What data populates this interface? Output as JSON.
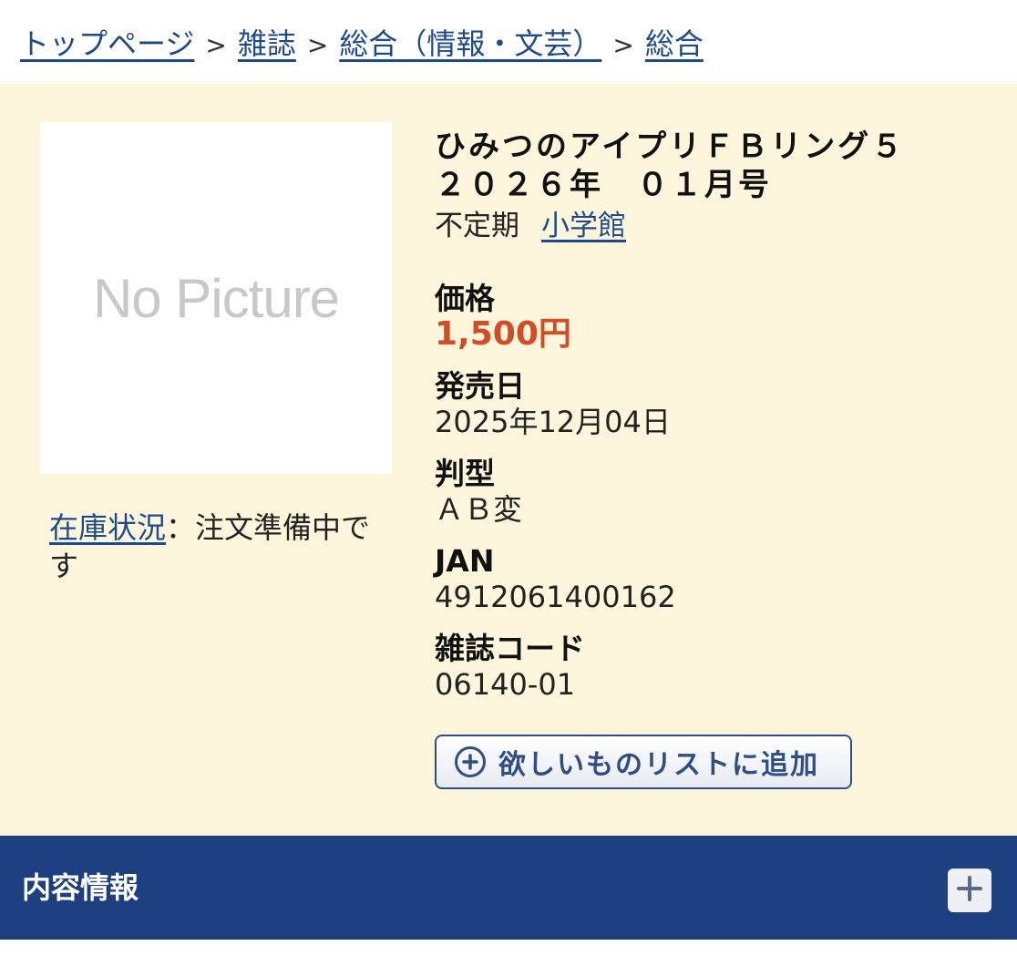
{
  "breadcrumb": {
    "items": [
      "トップページ",
      "雑誌",
      "総合（情報・文芸）",
      "総合"
    ],
    "separator": ">"
  },
  "image_placeholder": "No Picture",
  "stock": {
    "link_label": "在庫状況",
    "status": "：注文準備中です"
  },
  "product": {
    "title_line1": "ひみつのアイプリＦＢリング５",
    "title_line2": "２０２６年　０１月号",
    "frequency": "不定期",
    "publisher": "小学館"
  },
  "fields": {
    "price_label": "価格",
    "price_value": "1,500円",
    "release_label": "発売日",
    "release_value": "2025年12月04日",
    "size_label": "判型",
    "size_value": "ＡＢ変",
    "jan_label": "JAN",
    "jan_value": "4912061400162",
    "code_label": "雑誌コード",
    "code_value": "06140-01"
  },
  "wishlist_button": {
    "label": "欲しいものリストに追加",
    "icon": "plus-circle-icon"
  },
  "section": {
    "title": "内容情報",
    "icon": "plus-icon"
  },
  "colors": {
    "link": "#1f4a8a",
    "price": "#d24d26",
    "product_bg": "#fdf6dd",
    "section_bar": "#1e3f7f"
  }
}
